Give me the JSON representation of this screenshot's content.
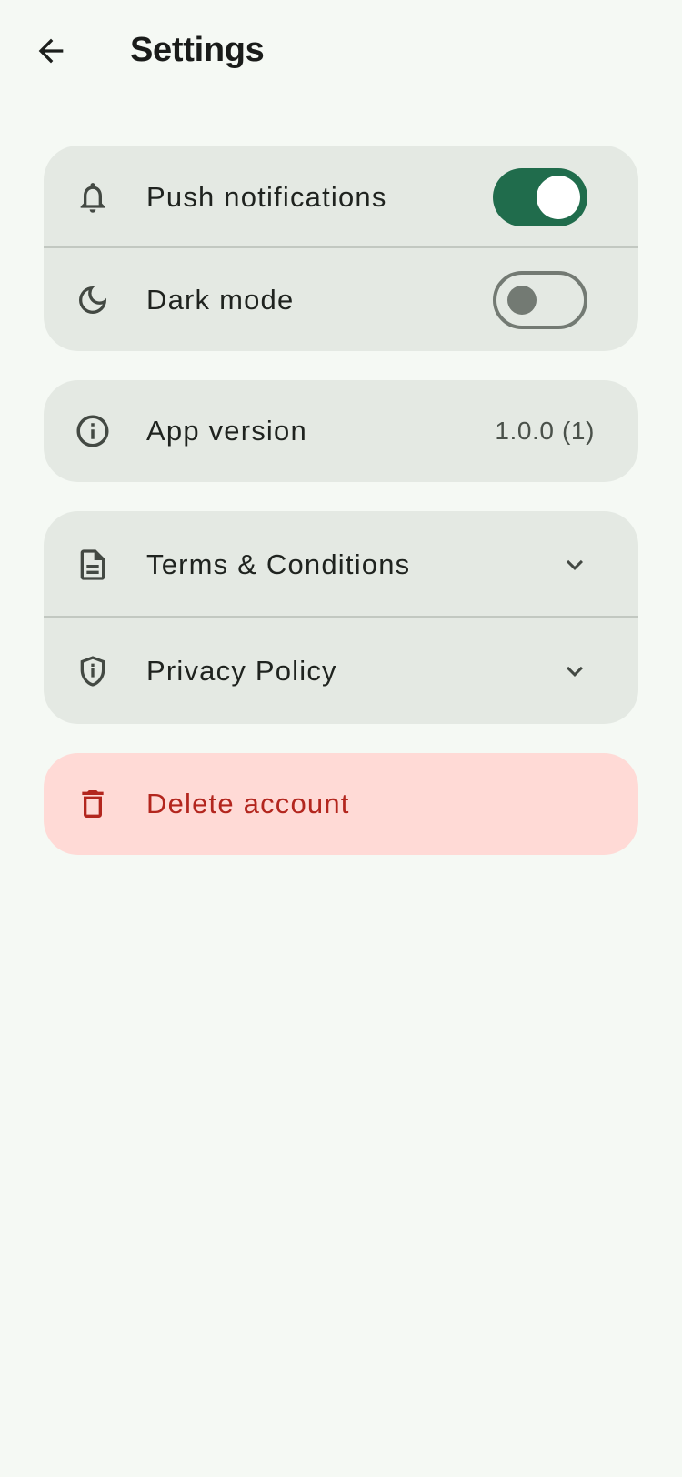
{
  "header": {
    "title": "Settings",
    "back_icon": "arrow-back-icon"
  },
  "colors": {
    "background": "#f5f9f4",
    "card": "#e4e9e3",
    "accent": "#206c4c",
    "danger_bg": "#ffdad6",
    "danger_text": "#b3261e"
  },
  "preferences": {
    "push_notifications": {
      "label": "Push notifications",
      "icon": "bell-icon",
      "enabled": true
    },
    "dark_mode": {
      "label": "Dark mode",
      "icon": "moon-icon",
      "enabled": false
    }
  },
  "about": {
    "app_version": {
      "label": "App version",
      "icon": "info-icon",
      "value": "1.0.0 (1)"
    }
  },
  "legal": {
    "terms": {
      "label": "Terms & Conditions",
      "icon": "document-icon"
    },
    "privacy": {
      "label": "Privacy Policy",
      "icon": "shield-info-icon"
    }
  },
  "account": {
    "delete": {
      "label": "Delete account",
      "icon": "trash-icon"
    }
  }
}
